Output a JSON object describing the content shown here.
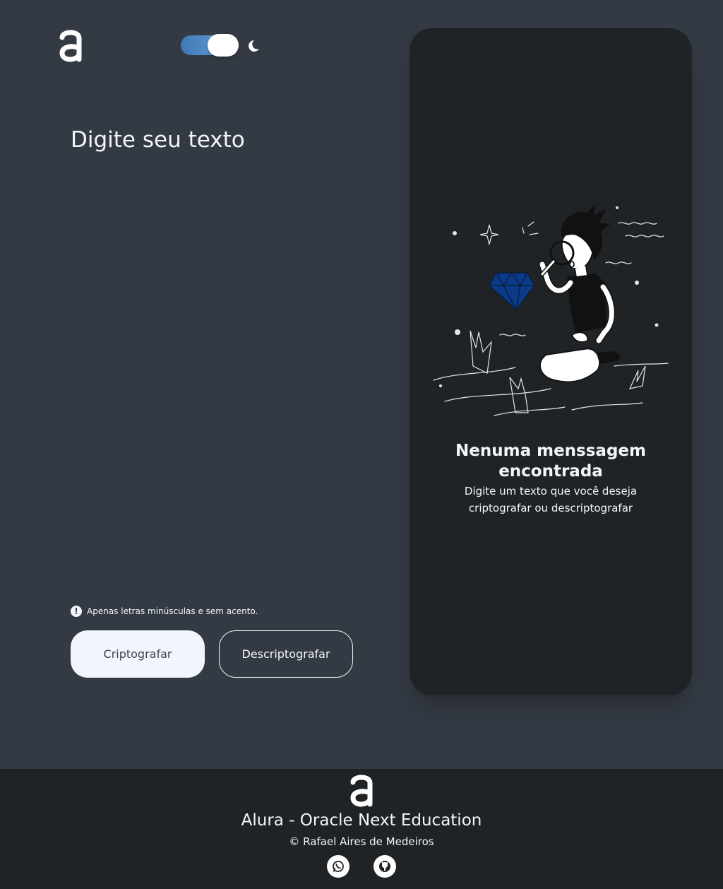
{
  "header": {
    "logo_icon": "alura-logo-icon",
    "theme_toggle": {
      "state": "on",
      "icon": "moon-icon"
    }
  },
  "input": {
    "placeholder": "Digite seu texto",
    "value": ""
  },
  "hint": {
    "icon": "exclamation-circle-icon",
    "text": "Apenas letras minúsculas e sem acento."
  },
  "buttons": {
    "encrypt_label": "Criptografar",
    "decrypt_label": "Descriptografar"
  },
  "output": {
    "illustration": "boy-with-magnifying-glass-diamond-illustration",
    "title": "Nenuma menssagem encontrada",
    "description": "Digite um texto que você deseja criptografar ou descriptografar"
  },
  "footer": {
    "logo_icon": "alura-logo-icon",
    "title": "Alura - Oracle Next Education",
    "copyright": "© Rafael Aires de Medeiros",
    "social": [
      "whatsapp-icon",
      "github-icon"
    ]
  },
  "colors": {
    "background": "#343a44",
    "panel": "#202326",
    "text": "#f3f5fc",
    "toggle_accent": "#4f8ecb",
    "diamond": "#0a3a8a"
  }
}
